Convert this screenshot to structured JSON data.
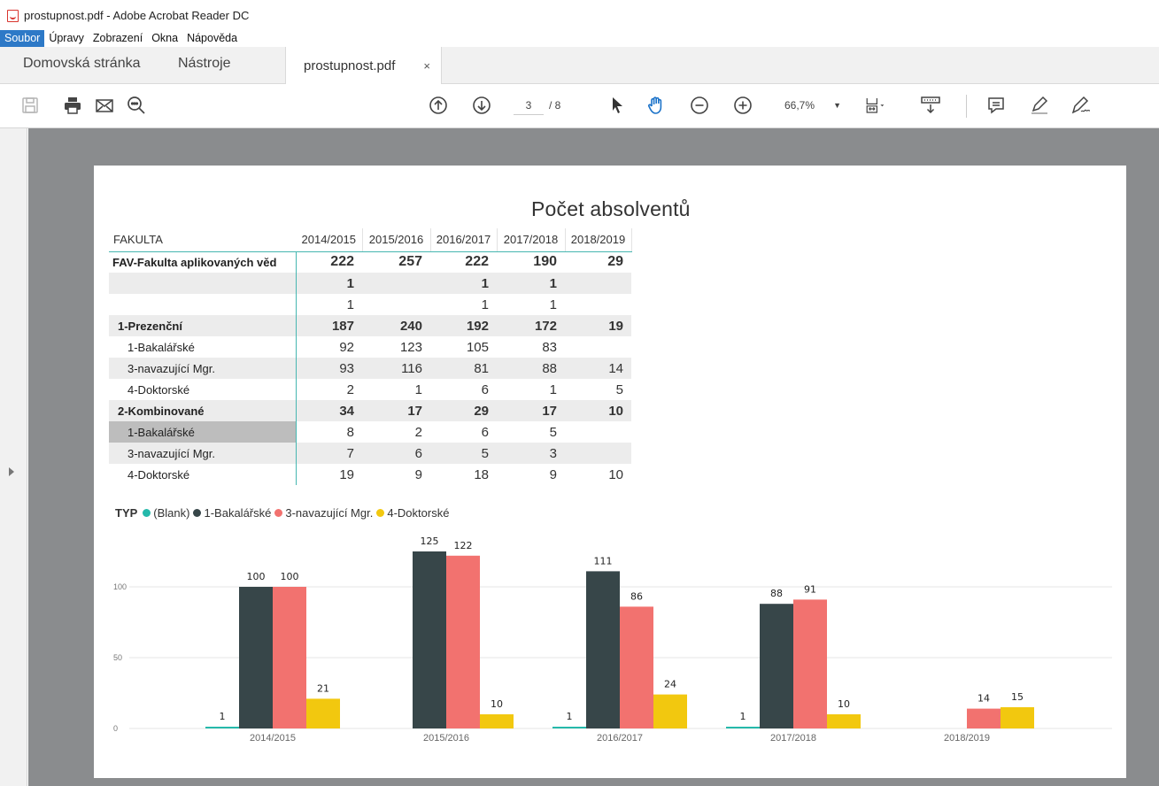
{
  "window": {
    "title": "prostupnost.pdf - Adobe Acrobat Reader DC"
  },
  "menu": {
    "items": [
      "Soubor",
      "Úpravy",
      "Zobrazení",
      "Okna",
      "Nápověda"
    ]
  },
  "tabs": {
    "home": "Domovská stránka",
    "tools": "Nástroje",
    "document": "prostupnost.pdf",
    "close": "×"
  },
  "toolbar": {
    "page_current": "3",
    "page_total": "/ 8",
    "zoom": "66,7%"
  },
  "icons": {
    "save": "save-icon",
    "print": "print-icon",
    "email": "email-icon",
    "search": "search-icon",
    "prev": "arrow-up-circle-icon",
    "next": "arrow-down-circle-icon",
    "select": "pointer-icon",
    "hand": "hand-icon",
    "zoom_out": "zoom-out-icon",
    "zoom_in": "zoom-in-icon",
    "fit": "fit-page-icon",
    "scroll": "scroll-mode-icon",
    "comment": "comment-icon",
    "highlight": "pen-icon",
    "sign": "sign-icon"
  },
  "colors": {
    "blank": "#25b9ab",
    "bakalarske": "#374649",
    "navazujici": "#f2726f",
    "doktorske": "#f2c80f",
    "menu_active": "#2d79c7"
  },
  "report": {
    "title": "Počet absolventů",
    "table": {
      "header": [
        "FAKULTA",
        "2014/2015",
        "2015/2016",
        "2016/2017",
        "2017/2018",
        "2018/2019"
      ],
      "rows": [
        {
          "label": "FAV-Fakulta aplikovaných věd",
          "values": [
            "222",
            "257",
            "222",
            "190",
            "29"
          ]
        },
        {
          "label": "",
          "values": [
            "1",
            "",
            "1",
            "1",
            ""
          ]
        },
        {
          "label": "",
          "values": [
            "1",
            "",
            "1",
            "1",
            ""
          ]
        },
        {
          "label": "1-Prezenční",
          "values": [
            "187",
            "240",
            "192",
            "172",
            "19"
          ]
        },
        {
          "label": "1-Bakalářské",
          "values": [
            "92",
            "123",
            "105",
            "83",
            ""
          ]
        },
        {
          "label": "3-navazující Mgr.",
          "values": [
            "93",
            "116",
            "81",
            "88",
            "14"
          ]
        },
        {
          "label": "4-Doktorské",
          "values": [
            "2",
            "1",
            "6",
            "1",
            "5"
          ]
        },
        {
          "label": "2-Kombinované",
          "values": [
            "34",
            "17",
            "29",
            "17",
            "10"
          ]
        },
        {
          "label": "1-Bakalářské",
          "values": [
            "8",
            "2",
            "6",
            "5",
            ""
          ]
        },
        {
          "label": "3-navazující Mgr.",
          "values": [
            "7",
            "6",
            "5",
            "3",
            ""
          ]
        },
        {
          "label": "4-Doktorské",
          "values": [
            "19",
            "9",
            "18",
            "9",
            "10"
          ]
        }
      ]
    },
    "legend": {
      "title": "TYP",
      "items": [
        "(Blank)",
        "1-Bakalářské",
        "3-navazující Mgr.",
        "4-Doktorské"
      ]
    }
  },
  "chart_data": {
    "type": "bar",
    "categories": [
      "2014/2015",
      "2015/2016",
      "2016/2017",
      "2017/2018",
      "2018/2019"
    ],
    "series": [
      {
        "name": "(Blank)",
        "values": [
          1,
          null,
          1,
          1,
          null
        ]
      },
      {
        "name": "1-Bakalářské",
        "values": [
          100,
          125,
          111,
          88,
          null
        ]
      },
      {
        "name": "3-navazující Mgr.",
        "values": [
          100,
          122,
          86,
          91,
          14
        ]
      },
      {
        "name": "4-Doktorské",
        "values": [
          21,
          10,
          24,
          10,
          15
        ]
      }
    ],
    "yticks": [
      0,
      50,
      100
    ],
    "ylim": [
      0,
      130
    ],
    "grid": true,
    "legend_position": "top-left"
  }
}
